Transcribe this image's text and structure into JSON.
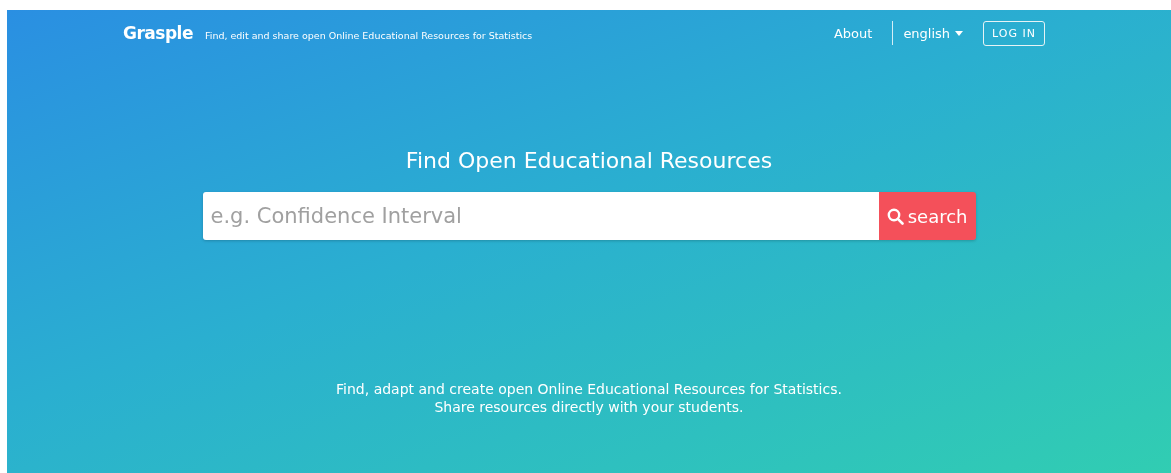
{
  "header": {
    "logo": "Grasple",
    "tagline": "Find, edit and share open Online Educational Resources for Statistics",
    "nav": {
      "about": "About",
      "language": "english",
      "login": "LOG IN"
    }
  },
  "hero": {
    "title": "Find Open Educational Resources",
    "search": {
      "placeholder": "e.g. Confidence Interval",
      "button": "search"
    },
    "description": [
      "Find, adapt and create open Online Educational Resources for Statistics.",
      "Share resources directly with your students."
    ]
  }
}
